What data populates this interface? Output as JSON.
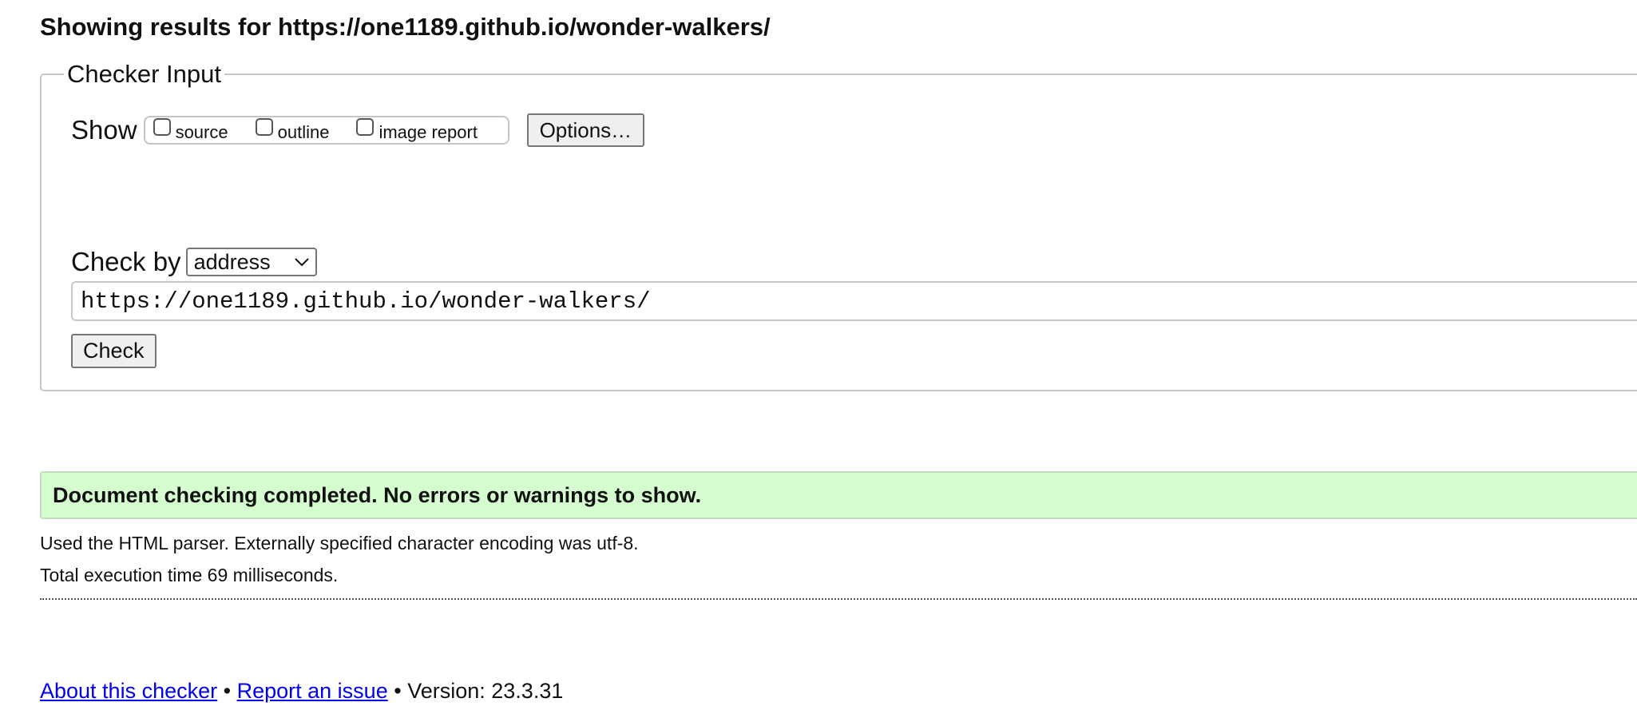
{
  "header": {
    "title": "Showing results for https://one1189.github.io/wonder-walkers/"
  },
  "checker_input": {
    "legend": "Checker Input",
    "show_label": "Show",
    "checkboxes": [
      {
        "label": "source",
        "checked": false
      },
      {
        "label": "outline",
        "checked": false
      },
      {
        "label": "image report",
        "checked": false
      }
    ],
    "options_label": "Options…",
    "check_by_label": "Check by",
    "check_by_value": "address",
    "url_value": "https://one1189.github.io/wonder-walkers/",
    "check_label": "Check"
  },
  "results": {
    "success_message": "Document checking completed. No errors or warnings to show.",
    "banner_color": "#d6fdd0",
    "parser_info": "Used the HTML parser. Externally specified character encoding was utf-8.",
    "execution_time": "Total execution time 69 milliseconds."
  },
  "footer": {
    "about_link": "About this checker",
    "separator": "•",
    "report_link": "Report an issue",
    "version": "Version: 23.3.31",
    "link_color": "#0000ee"
  }
}
